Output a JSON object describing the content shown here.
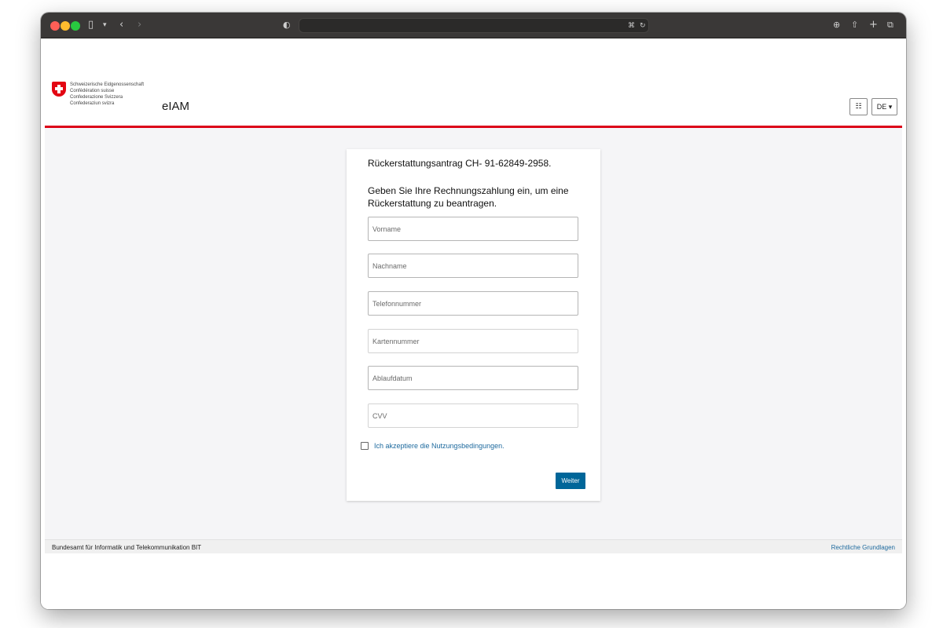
{
  "browser": {
    "url": "",
    "icons": [
      "sidebar-icon",
      "chevron-down-icon",
      "back-icon",
      "forward-icon",
      "shield-icon",
      "translate-icon",
      "reload-icon",
      "download-icon",
      "share-icon",
      "new-tab-icon",
      "tabs-overview-icon"
    ]
  },
  "header": {
    "logo_lines": [
      "Schweizerische Eidgenossenschaft",
      "Confédération suisse",
      "Confederazione Svizzera",
      "Confederaziun svizra"
    ],
    "app_title": "eIAM",
    "settings_icon": "settings-icon",
    "language": "DE ▾"
  },
  "form": {
    "title": "Rückerstattungsantrag CH- 91-62849-2958.",
    "description": "Geben Sie Ihre Rechnungszahlung ein, um eine Rückerstattung zu beantragen.",
    "fields": [
      {
        "placeholder": "Vorname"
      },
      {
        "placeholder": "Nachname"
      },
      {
        "placeholder": "Telefonnummer"
      },
      {
        "placeholder": "Kartennummer"
      },
      {
        "placeholder": "Ablaufdatum"
      },
      {
        "placeholder": "CVV"
      }
    ],
    "terms_label": "Ich akzeptiere die Nutzungsbedingungen.",
    "submit_label": "Weiter"
  },
  "footer": {
    "left": "Bundesamt für Informatik und Telekommunikation BIT",
    "right": "Rechtliche Grundlagen"
  },
  "colors": {
    "accent_red": "#dc0018",
    "button_blue": "#006699",
    "link_blue": "#1e6a9e"
  }
}
